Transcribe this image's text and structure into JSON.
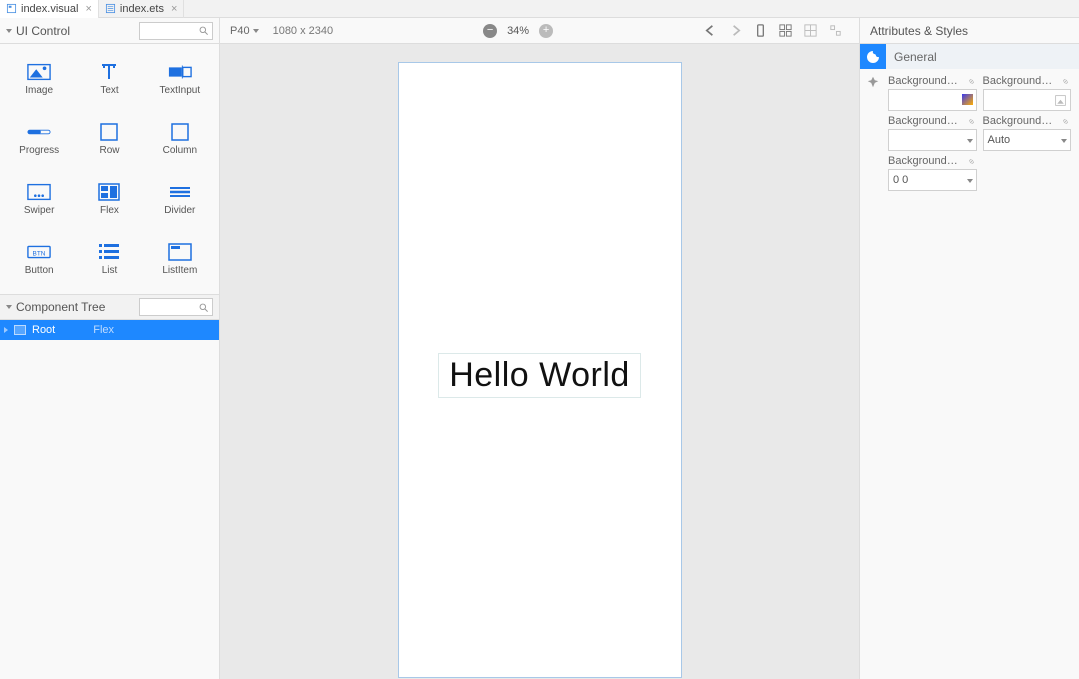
{
  "tabs": [
    {
      "label": "index.visual",
      "active": true
    },
    {
      "label": "index.ets",
      "active": false
    }
  ],
  "left": {
    "ui_control_title": "UI Control",
    "controls": [
      {
        "name": "Image",
        "icon": "image"
      },
      {
        "name": "Text",
        "icon": "text"
      },
      {
        "name": "TextInput",
        "icon": "textinput"
      },
      {
        "name": "Progress",
        "icon": "progress"
      },
      {
        "name": "Row",
        "icon": "row"
      },
      {
        "name": "Column",
        "icon": "column"
      },
      {
        "name": "Swiper",
        "icon": "swiper"
      },
      {
        "name": "Flex",
        "icon": "flex"
      },
      {
        "name": "Divider",
        "icon": "divider"
      },
      {
        "name": "Button",
        "icon": "button"
      },
      {
        "name": "List",
        "icon": "list"
      },
      {
        "name": "ListItem",
        "icon": "listitem"
      }
    ],
    "component_tree_title": "Component Tree",
    "tree": {
      "root_label": "Root",
      "root_type": "Flex"
    }
  },
  "canvas": {
    "device": "P40",
    "dimensions": "1080 x 2340",
    "zoom": "34%",
    "preview_text": "Hello World"
  },
  "right": {
    "header": "Attributes & Styles",
    "section": "General",
    "attrs": {
      "bg_color_label": "BackgroundC...",
      "bg_image_label": "BackgroundI...",
      "bg_image2_label": "BackgroundI...",
      "bg_image3_label": "BackgroundI...",
      "bg_image3_value": "Auto",
      "bg_image4_label": "BackgroundI...",
      "bg_image4_value": "0 0"
    }
  }
}
